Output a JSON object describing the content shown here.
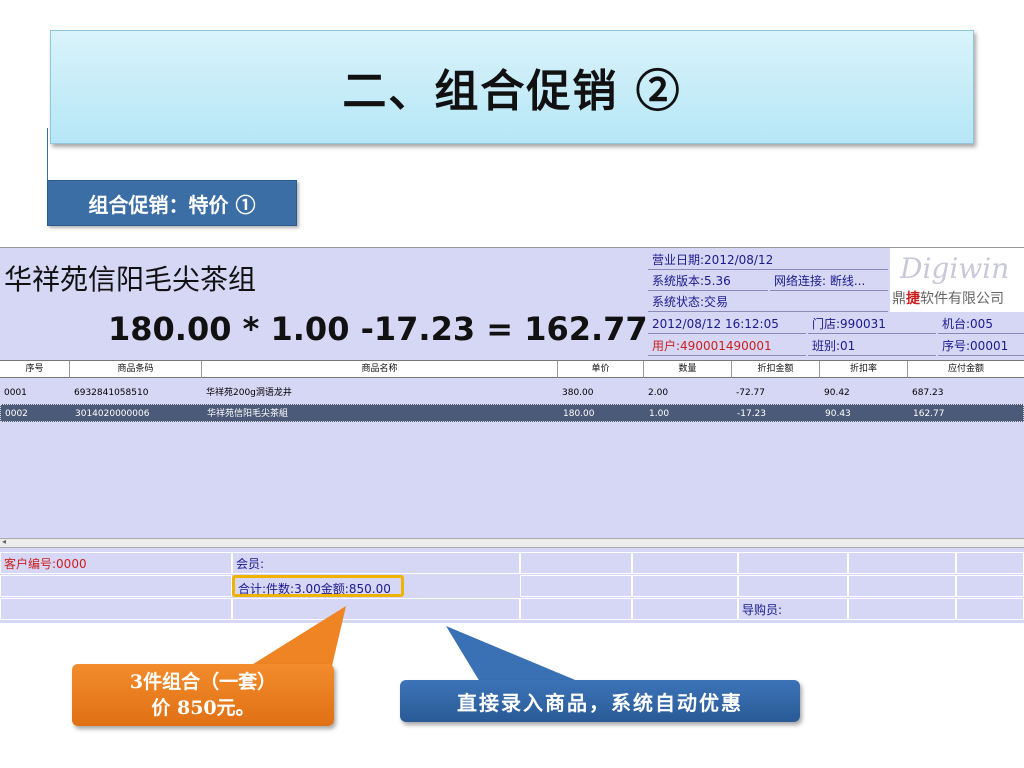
{
  "slide": {
    "title": "二、组合促销 ②",
    "subtitle": "组合促销：特价 ①"
  },
  "pos": {
    "product_name": "华祥苑信阳毛尖茶组",
    "calc_line": "180.00 * 1.00 -17.23 = 162.77",
    "info": {
      "business_date": "营业日期:2012/08/12",
      "version": "系统版本:5.36",
      "network": "网络连接: 断线...",
      "status": "系统状态:交易",
      "datetime": "2012/08/12 16:12:05",
      "store": "门店:990031",
      "machine": "机台:005",
      "user": "用户:490001490001",
      "shift": "班别:01",
      "serial": "序号:00001"
    },
    "logo": {
      "script": "Digiwin",
      "company_prefix": "鼎",
      "company_red": "捷",
      "company_suffix": "软件有限公司"
    },
    "columns": [
      "序号",
      "商品条码",
      "商品名称",
      "单价",
      "数量",
      "折扣金额",
      "折扣率",
      "应付金额"
    ],
    "rows": [
      {
        "seq": "0001",
        "barcode": "6932841058510",
        "name": "华祥苑200g洞语龙井",
        "price": "380.00",
        "qty": "2.00",
        "discount": "-72.77",
        "rate": "90.42",
        "payable": "687.23"
      },
      {
        "seq": "0002",
        "barcode": "3014020000006",
        "name": "华祥苑信阳毛尖茶組",
        "price": "180.00",
        "qty": "1.00",
        "discount": "-17.23",
        "rate": "90.43",
        "payable": "162.77"
      }
    ],
    "selected_row": 1,
    "footer": {
      "customer_no": "客户编号:0000",
      "member": "会员:",
      "total": "合计:件数:3.00金额:850.00",
      "guide": "导购员:"
    }
  },
  "callouts": {
    "orange_line1": "3件组合（一套）",
    "orange_line2": "价 850元。",
    "blue": "直接录入商品，系统自动优惠"
  },
  "colors": {
    "title_bg": "#c4ebf8",
    "subtitle_bg": "#3a6ea5",
    "pos_bg": "#d6d6f5",
    "selected_row": "#4b5a78",
    "highlight": "#f0b400",
    "orange": "#e87d1e",
    "blue": "#3568a8"
  }
}
